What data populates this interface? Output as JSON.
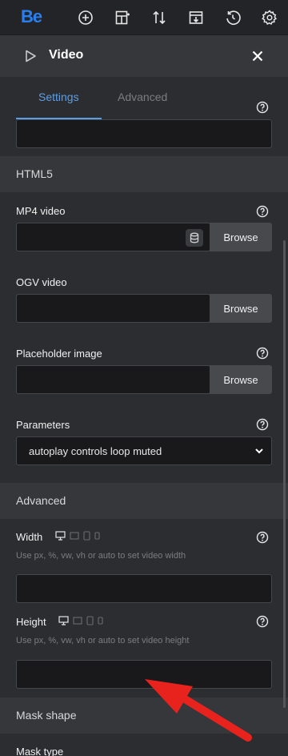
{
  "topbar": {
    "logo": "Be",
    "icons": [
      "add-icon",
      "layout-icon",
      "sort-icon",
      "import-icon",
      "history-icon",
      "settings-gear-icon"
    ]
  },
  "panel": {
    "title": "Video",
    "icon": "play-icon",
    "close_icon": "close-icon"
  },
  "tabs": {
    "settings": "Settings",
    "advanced": "Advanced",
    "active": "Settings"
  },
  "sections": {
    "html5": "HTML5",
    "advanced": "Advanced",
    "mask_shape": "Mask shape"
  },
  "fields": {
    "mp4": {
      "label": "MP4 video",
      "value": "",
      "browse": "Browse"
    },
    "ogv": {
      "label": "OGV video",
      "value": "",
      "browse": "Browse"
    },
    "placeholder": {
      "label": "Placeholder image",
      "value": "",
      "browse": "Browse"
    },
    "parameters": {
      "label": "Parameters",
      "value": "autoplay controls loop muted"
    },
    "width": {
      "label": "Width",
      "hint": "Use px, %, vw, vh or auto to set video width",
      "value": ""
    },
    "height": {
      "label": "Height",
      "hint": "Use px, %, vw, vh or auto to set video height",
      "value": ""
    },
    "mask_type": {
      "label": "Mask type"
    }
  },
  "colors": {
    "accent": "#5c9ee6",
    "logo": "#2a7ff0",
    "annotation_arrow": "#e8231e"
  }
}
